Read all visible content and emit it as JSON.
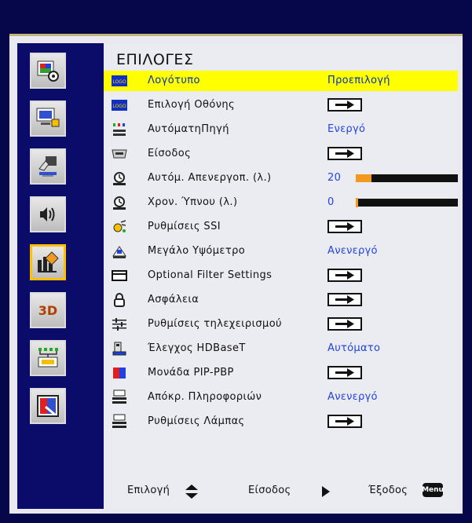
{
  "menu": {
    "title": "ΕΠΙΛΟΓΕΣ",
    "items": [
      {
        "label": "Λογότυπο",
        "value": "Προεπιλογή",
        "icon": "logo-icon",
        "selected": true
      },
      {
        "label": "Επιλογή Οθόνης",
        "icon": "logo-capture-icon",
        "control": "arrow"
      },
      {
        "label": "ΑυτόματηΠηγή",
        "value": "Ενεργό",
        "icon": "auto-source-icon"
      },
      {
        "label": "Είσοδος",
        "icon": "input-port-icon",
        "control": "arrow"
      },
      {
        "label": "Αυτόμ. Απενεργοπ. (λ.)",
        "value": "20",
        "icon": "auto-power-off-icon",
        "slider": 0.15
      },
      {
        "label": "Χρον. Ύπνου (λ.)",
        "value": "0",
        "icon": "sleep-timer-icon",
        "slider": 0.0
      },
      {
        "label": "Ρυθμίσεις SSI",
        "icon": "ssi-settings-icon",
        "control": "arrow"
      },
      {
        "label": "Μεγάλο Υψόμετρο",
        "value": "Ανενεργό",
        "icon": "high-altitude-icon"
      },
      {
        "label": "Optional Filter Settings",
        "icon": "filter-icon",
        "control": "arrow"
      },
      {
        "label": "Ασφάλεια",
        "icon": "security-icon",
        "control": "arrow"
      },
      {
        "label": "Ρυθμίσεις τηλεχειρισμού",
        "icon": "remote-settings-icon",
        "control": "arrow"
      },
      {
        "label": "Έλεγχος HDBaseT",
        "value": "Αυτόματο",
        "icon": "hdbaset-icon"
      },
      {
        "label": "Μονάδα PIP-PBP",
        "icon": "pip-pbp-icon",
        "control": "arrow"
      },
      {
        "label": "Απόκρ. Πληροφοριών",
        "value": "Ανενεργό",
        "icon": "info-hide-icon"
      },
      {
        "label": "Ρυθμίσεις Λάμπας",
        "icon": "lamp-settings-icon",
        "control": "arrow"
      }
    ]
  },
  "sidebar": {
    "items": [
      {
        "icon": "image-settings-icon"
      },
      {
        "icon": "screen-settings-icon"
      },
      {
        "icon": "settings-hand-icon"
      },
      {
        "icon": "volume-icon"
      },
      {
        "icon": "options-icon",
        "selected": true
      },
      {
        "icon": "3d-icon",
        "label": "3D"
      },
      {
        "icon": "lan-icon"
      },
      {
        "icon": "lamp-icon"
      }
    ]
  },
  "footer": {
    "select_label": "Επιλογή",
    "enter_label": "Είσοδος",
    "exit_label": "Έξοδος",
    "menu_key": "Menu"
  },
  "colors": {
    "background": "#06064a",
    "sidebar": "#0b0b6a",
    "panel": "#ebebf2",
    "highlight": "#ffff00",
    "value_blue": "#2244dd",
    "slider_fill": "#f39a1e"
  }
}
